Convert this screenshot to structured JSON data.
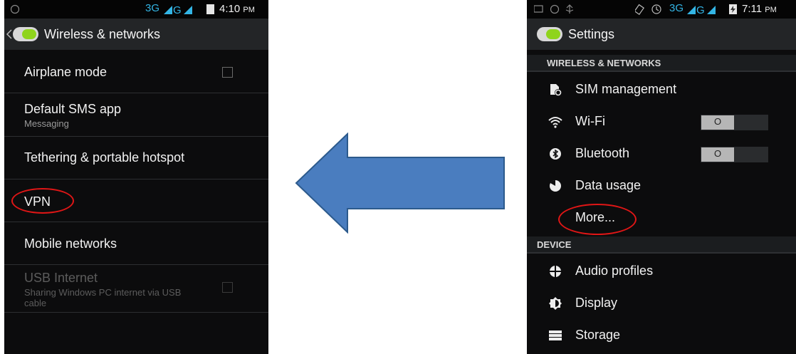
{
  "left_screen": {
    "status": {
      "network": "3G",
      "time": "4:10",
      "ampm": "PM"
    },
    "title": "Wireless & networks",
    "items": [
      {
        "title": "Airplane mode",
        "subtitle": ""
      },
      {
        "title": "Default SMS app",
        "subtitle": "Messaging"
      },
      {
        "title": "Tethering & portable hotspot",
        "subtitle": ""
      },
      {
        "title": "VPN",
        "subtitle": ""
      },
      {
        "title": "Mobile networks",
        "subtitle": ""
      },
      {
        "title": "USB Internet",
        "subtitle": "Sharing Windows PC internet via USB cable"
      }
    ]
  },
  "right_screen": {
    "status": {
      "network": "3G",
      "time": "7:11",
      "ampm": "PM"
    },
    "title": "Settings",
    "sections": [
      {
        "header": "WIRELESS & NETWORKS",
        "items": [
          "SIM management",
          "Wi-Fi",
          "Bluetooth",
          "Data usage",
          "More..."
        ]
      },
      {
        "header": "DEVICE",
        "items": [
          "Audio profiles",
          "Display",
          "Storage"
        ]
      }
    ],
    "toggle_label": "O"
  },
  "colors": {
    "signal": "#33b5e5",
    "annotation": "#e01616",
    "arrow_fill": "#4a7dbf",
    "arrow_stroke": "#2c5a8c"
  }
}
